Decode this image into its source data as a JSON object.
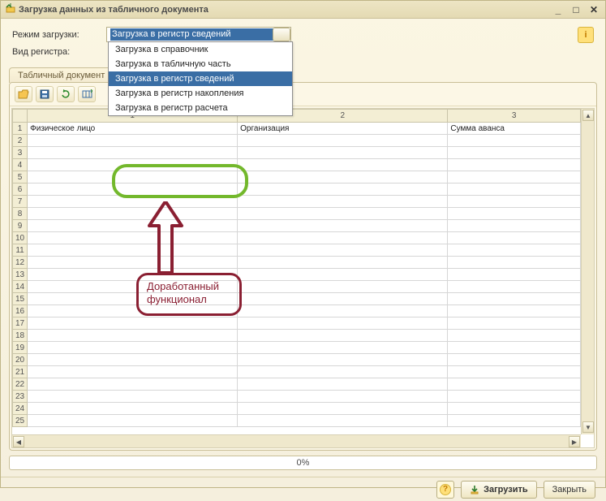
{
  "window": {
    "title": "Загрузка данных из табличного документа"
  },
  "form": {
    "mode_label": "Режим загрузки:",
    "mode_selected": "Загрузка в регистр сведений",
    "register_label": "Вид регистра:"
  },
  "dropdown_options": [
    "Загрузка в справочник",
    "Загрузка в табличную часть",
    "Загрузка в регистр сведений",
    "Загрузка в регистр накопления",
    "Загрузка в регистр расчета"
  ],
  "dropdown_highlight_index": 2,
  "tab": {
    "label": "Табличный документ"
  },
  "grid": {
    "col_numbers": [
      "1",
      "2",
      "3"
    ],
    "headers": [
      "Физическое лицо",
      "Организация",
      "Сумма аванса"
    ],
    "row_count": 25
  },
  "progress": {
    "text": "0%"
  },
  "footer": {
    "load": "Загрузить",
    "close": "Закрыть"
  },
  "annotation": {
    "line1": "Доработанный",
    "line2": "функционал"
  }
}
